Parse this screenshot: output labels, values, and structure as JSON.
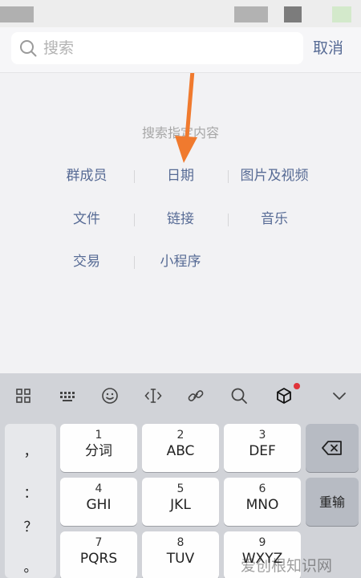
{
  "search": {
    "placeholder": "搜索",
    "cancel_label": "取消"
  },
  "content": {
    "hint": "搜索指定内容",
    "options": [
      "群成员",
      "日期",
      "图片及视频",
      "文件",
      "链接",
      "音乐",
      "交易",
      "小程序"
    ]
  },
  "keyboard": {
    "toolbar_icons": [
      "grid-icon",
      "keyboard-icon",
      "emoji-icon",
      "cursor-icon",
      "link-icon",
      "search-icon",
      "cube-icon",
      "chevron-down-icon"
    ],
    "punctuation": [
      "，",
      "：",
      "？",
      "。"
    ],
    "keys": [
      {
        "num": "1",
        "letters": "分词"
      },
      {
        "num": "2",
        "letters": "ABC"
      },
      {
        "num": "3",
        "letters": "DEF"
      },
      {
        "num": "4",
        "letters": "GHI"
      },
      {
        "num": "5",
        "letters": "JKL"
      },
      {
        "num": "6",
        "letters": "MNO"
      },
      {
        "num": "7",
        "letters": "PQRS"
      },
      {
        "num": "8",
        "letters": "TUV"
      },
      {
        "num": "9",
        "letters": "WXYZ"
      }
    ],
    "retype_label": "重输"
  },
  "watermark": "爱创根知识网",
  "colors": {
    "link": "#576b95",
    "annotation_arrow": "#f07a2e",
    "notify_dot": "#e0333a"
  }
}
